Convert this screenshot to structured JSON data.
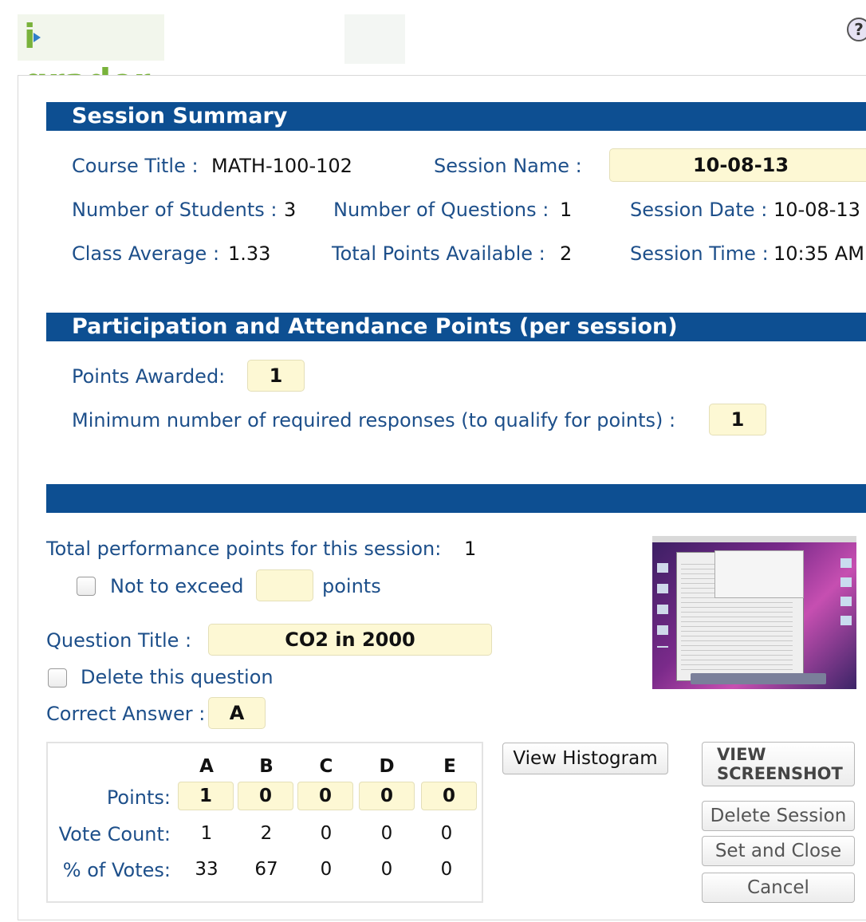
{
  "app": {
    "logo_text_i": "i",
    "logo_text_rest": "grader",
    "help_glyph": "?"
  },
  "summary": {
    "heading": "Session Summary",
    "course_title_label": "Course Title :",
    "course_title_value": "MATH-100-102",
    "session_name_label": "Session Name :",
    "session_name_value": "10-08-13",
    "num_students_label": "Number of Students :",
    "num_students_value": "3",
    "num_questions_label": "Number of Questions :",
    "num_questions_value": "1",
    "session_date_label": "Session Date :",
    "session_date_value": "10-08-13",
    "class_average_label": "Class Average :",
    "class_average_value": "1.33",
    "total_points_label": "Total Points Available :",
    "total_points_value": "2",
    "session_time_label": "Session Time :",
    "session_time_value": "10:35 AM"
  },
  "participation": {
    "heading": "Participation and Attendance Points (per session)",
    "points_awarded_label": "Points Awarded:",
    "points_awarded_value": "1",
    "min_responses_label": "Minimum number of required responses (to qualify for points) :",
    "min_responses_value": "1"
  },
  "question": {
    "heading": "",
    "total_perf_label": "Total performance points for this session:",
    "total_perf_value": "1",
    "not_exceed_label": "Not to exceed",
    "not_exceed_value": "",
    "not_exceed_suffix": "points",
    "title_label": "Question Title :",
    "title_value": "CO2 in 2000",
    "delete_label": "Delete this question",
    "correct_label": "Correct Answer :",
    "correct_value": "A",
    "columns": [
      "A",
      "B",
      "C",
      "D",
      "E"
    ],
    "points_label": "Points:",
    "points": [
      "1",
      "0",
      "0",
      "0",
      "0"
    ],
    "vote_count_label": "Vote Count:",
    "vote_counts": [
      "1",
      "2",
      "0",
      "0",
      "0"
    ],
    "pct_label": "% of Votes:",
    "pct_votes": [
      "33",
      "67",
      "0",
      "0",
      "0"
    ]
  },
  "buttons": {
    "view_histogram": "View Histogram",
    "view_screenshot_line1": "VIEW",
    "view_screenshot_line2": "SCREENSHOT",
    "delete_session": "Delete Session",
    "set_and_close": "Set and Close",
    "cancel": "Cancel"
  },
  "colors": {
    "band": "#0d4f92",
    "label_text": "#1d4f8a",
    "input_yellow": "#fdf8d4",
    "logo_green": "#79b23b",
    "logo_arrow_blue": "#2f7fc9"
  },
  "icons": {
    "help": "question-circle-icon",
    "screenshot": "screenshot-thumbnail"
  }
}
